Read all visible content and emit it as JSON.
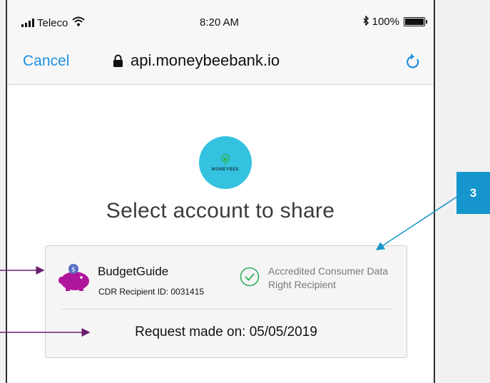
{
  "status_bar": {
    "carrier": "Teleco",
    "time": "8:20 AM",
    "battery": "100%",
    "battery_level": 1.0,
    "icons": [
      "signal-icon",
      "wifi-icon",
      "bluetooth-icon",
      "battery-icon"
    ]
  },
  "nav_bar": {
    "cancel_label": "Cancel",
    "url": "api.moneybeebank.io",
    "icons": [
      "lock-icon",
      "reload-icon"
    ]
  },
  "logo": {
    "text": "MONEYBEE",
    "color": "#34c2e0"
  },
  "heading": "Select account to share",
  "card": {
    "app_name": "BudgetGuide",
    "recipient_id": "CDR Recipient ID: 0031415",
    "accreditation": "Accredited Consumer Data Right Recipient",
    "request_text": "Request made on: 05/05/2019",
    "icons": [
      "piggy-bank-icon",
      "check-circle-icon"
    ]
  },
  "callout": {
    "number": "3",
    "color": "#1696cc"
  },
  "colors": {
    "link": "#1d8fe0",
    "arrow_purple": "#6b1f6f",
    "arrow_blue": "#1696cc",
    "piggy": "#b0169a"
  }
}
